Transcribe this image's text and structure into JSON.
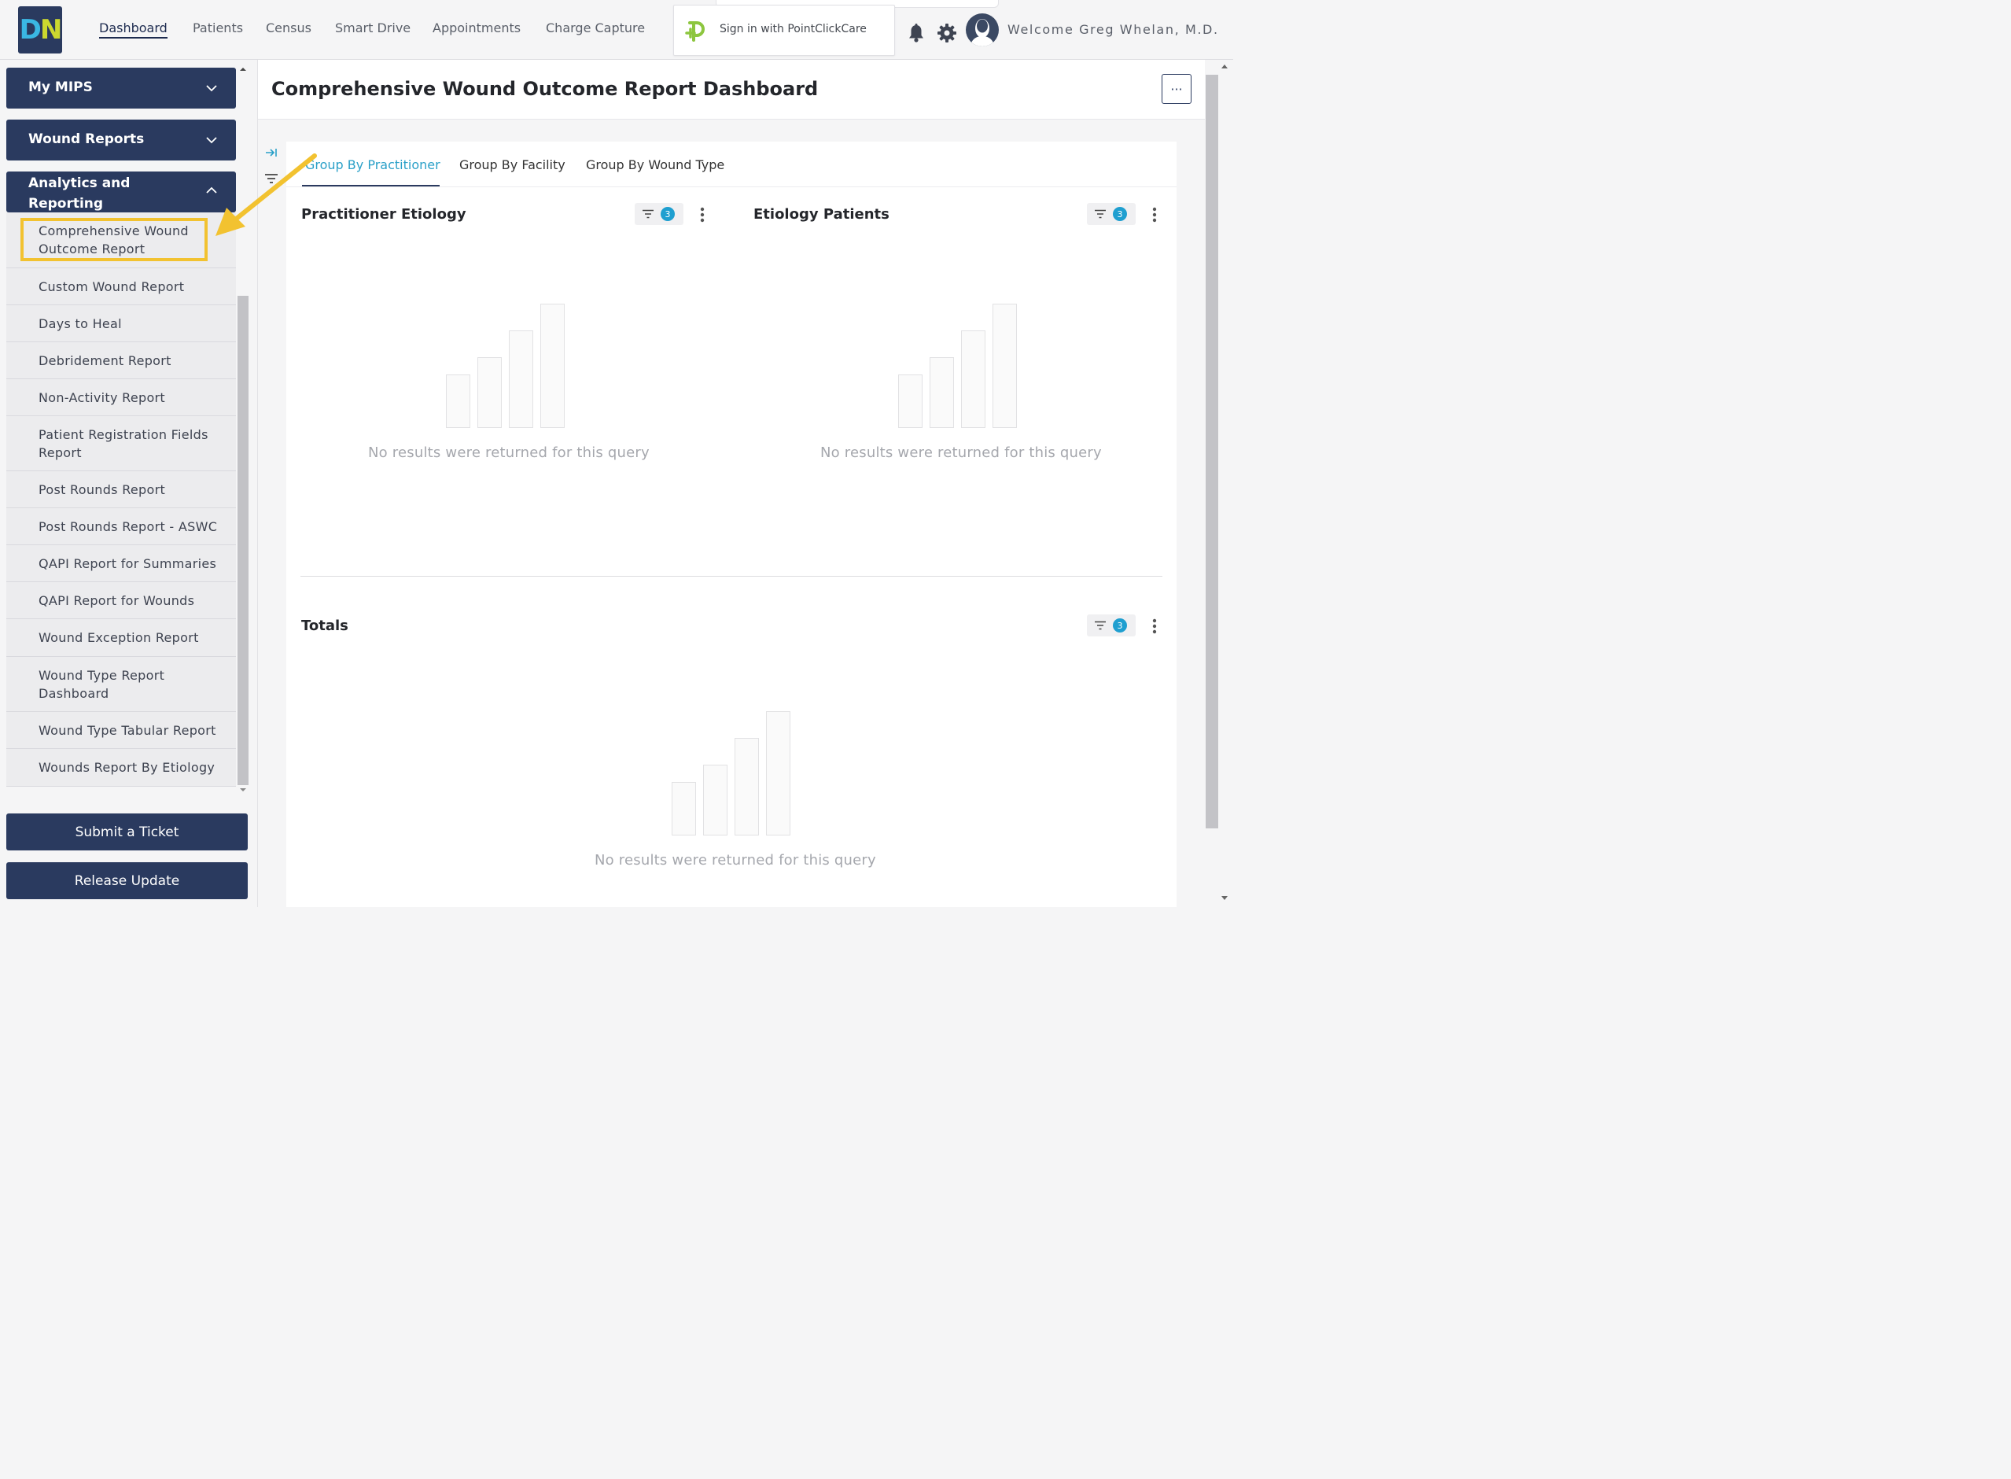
{
  "header": {
    "logo": "DN",
    "nav": [
      {
        "label": "Dashboard",
        "active": true
      },
      {
        "label": "Patients"
      },
      {
        "label": "Census"
      },
      {
        "label": "Smart Drive"
      },
      {
        "label": "Appointments"
      },
      {
        "label": "Charge Capture"
      }
    ],
    "pcc_signin": "Sign in with PointClickCare",
    "welcome": "Welcome Greg Whelan, M.D.",
    "icons": [
      "bell-icon",
      "gear-icon",
      "user-avatar-icon"
    ]
  },
  "sidebar": {
    "sections": [
      {
        "label": "My MIPS",
        "expanded": false
      },
      {
        "label": "Wound Reports",
        "expanded": false
      },
      {
        "label": "Analytics and Reporting",
        "expanded": true
      }
    ],
    "analytics_items": [
      "Comprehensive Wound Outcome Report",
      "Custom Wound Report",
      "Days to Heal",
      "Debridement Report",
      "Non-Activity Report",
      "Patient Registration Fields Report",
      "Post Rounds Report",
      "Post Rounds Report - ASWC",
      "QAPI Report for Summaries",
      "QAPI Report for Wounds",
      "Wound Exception Report",
      "Wound Type Report Dashboard",
      "Wound Type Tabular Report",
      "Wounds Report By Etiology"
    ],
    "highlighted_item": "Comprehensive Wound Outcome Report",
    "submit_ticket": "Submit a Ticket",
    "release_update": "Release Update"
  },
  "main": {
    "title": "Comprehensive Wound Outcome Report Dashboard",
    "more_button": "···",
    "tabs": [
      {
        "label": "Group By Practitioner",
        "active": true
      },
      {
        "label": "Group By Facility"
      },
      {
        "label": "Group By Wound Type"
      }
    ],
    "widgets": [
      {
        "title": "Practitioner Etiology",
        "filter_count": "3",
        "empty_message": "No results were returned for this query"
      },
      {
        "title": "Etiology Patients",
        "filter_count": "3",
        "empty_message": "No results were returned for this query"
      },
      {
        "title": "Totals",
        "filter_count": "3",
        "empty_message": "No results were returned for this query"
      }
    ]
  },
  "colors": {
    "navy": "#2a3a5f",
    "accent_tab": "#2aa0c8",
    "badge": "#1f9fd0",
    "highlight": "#f2c230",
    "pcc_green": "#8dc63f"
  }
}
